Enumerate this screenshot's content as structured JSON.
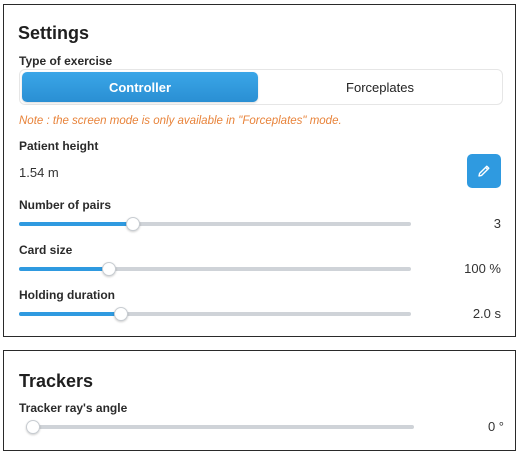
{
  "settings": {
    "title": "Settings",
    "exercise_type": {
      "label": "Type of exercise",
      "options": [
        "Controller",
        "Forceplates"
      ],
      "selected": "Controller"
    },
    "note": "Note : the screen mode is only available in \"Forceplates\" mode.",
    "patient_height": {
      "label": "Patient height",
      "value": "1.54 m",
      "edit_icon": "pencil-icon"
    },
    "number_of_pairs": {
      "label": "Number of pairs",
      "value": "3",
      "slider_level": 0.29
    },
    "card_size": {
      "label": "Card size",
      "value": "100 %",
      "slider_level": 0.23
    },
    "holding_duration": {
      "label": "Holding duration",
      "value": "2.0 s",
      "slider_level": 0.26
    }
  },
  "trackers": {
    "title": "Trackers",
    "ray_angle": {
      "label": "Tracker ray's angle",
      "value": "0 °",
      "slider_level": 0.0
    }
  },
  "colors": {
    "accent": "#2f9ae0",
    "note": "#e8833a",
    "track": "#cfd3d8"
  }
}
